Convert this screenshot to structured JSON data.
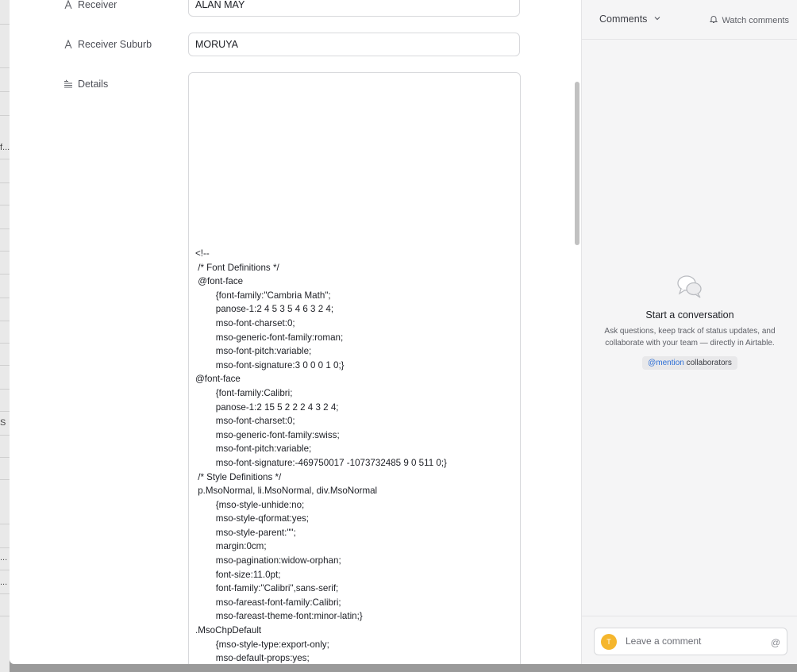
{
  "form": {
    "receiver": {
      "label": "Receiver",
      "value": "ALAN MAY"
    },
    "receiver_suburb": {
      "label": "Receiver Suburb",
      "value": "MORUYA"
    },
    "details": {
      "label": "Details",
      "text": "<!--\n /* Font Definitions */\n @font-face\n\t{font-family:\"Cambria Math\";\n\tpanose-1:2 4 5 3 5 4 6 3 2 4;\n\tmso-font-charset:0;\n\tmso-generic-font-family:roman;\n\tmso-font-pitch:variable;\n\tmso-font-signature:3 0 0 0 1 0;}\n@font-face\n\t{font-family:Calibri;\n\tpanose-1:2 15 5 2 2 2 4 3 2 4;\n\tmso-font-charset:0;\n\tmso-generic-font-family:swiss;\n\tmso-font-pitch:variable;\n\tmso-font-signature:-469750017 -1073732485 9 0 511 0;}\n /* Style Definitions */\n p.MsoNormal, li.MsoNormal, div.MsoNormal\n\t{mso-style-unhide:no;\n\tmso-style-qformat:yes;\n\tmso-style-parent:\"\";\n\tmargin:0cm;\n\tmso-pagination:widow-orphan;\n\tfont-size:11.0pt;\n\tfont-family:\"Calibri\",sans-serif;\n\tmso-fareast-font-family:Calibri;\n\tmso-fareast-theme-font:minor-latin;}\n.MsoChpDefault\n\t{mso-style-type:export-only;\n\tmso-default-props:yes;"
    }
  },
  "comments": {
    "tab_label": "Comments",
    "watch_label": "Watch comments",
    "empty_title": "Start a conversation",
    "empty_desc": "Ask questions, keep track of status updates, and collaborate with your team — directly in Airtable.",
    "mention_prefix": "@mention",
    "mention_suffix": " collaborators",
    "composer_placeholder": "Leave a comment",
    "avatar_initial": "T",
    "at_symbol": "@"
  },
  "background_grid": {
    "glyphs": [
      "f...",
      "S",
      "...",
      "..."
    ]
  },
  "colors": {
    "avatar": "#f5b62d",
    "mention_link": "#2d6fd6"
  }
}
